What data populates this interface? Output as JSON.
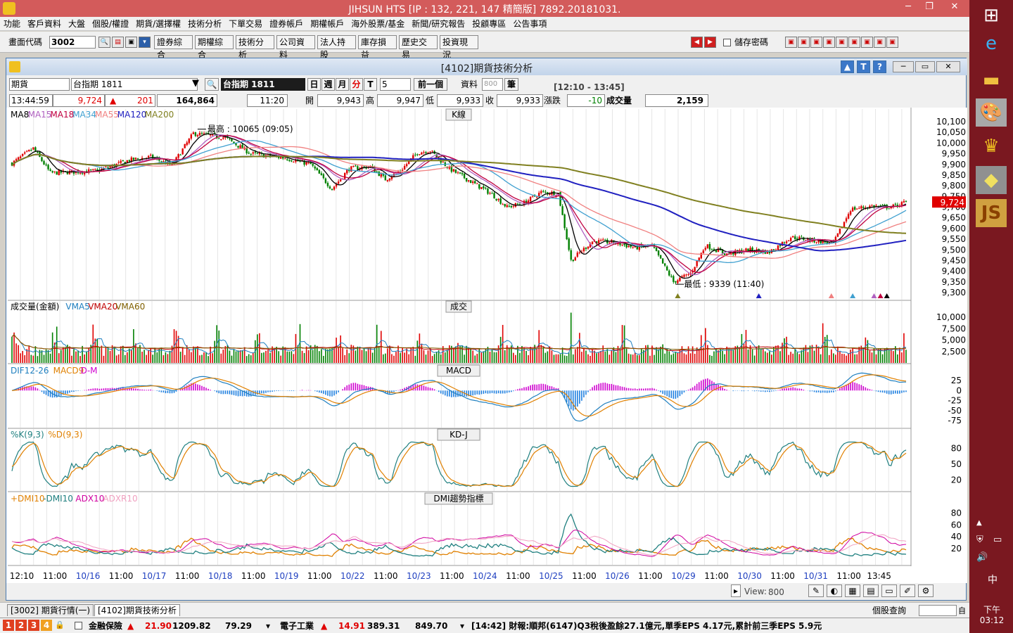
{
  "app": {
    "title": "JIHSUN HTS    [IP : 132, 221, 147 精簡版] 7892.20181031."
  },
  "menu": [
    "功能",
    "客戶資料",
    "大盤",
    "個股/權證",
    "期貨/選擇權",
    "技術分析",
    "下單交易",
    "證券帳戶",
    "期權帳戶",
    "海外股票/基金",
    "新聞/研究報告",
    "投顧專區",
    "公告事項"
  ],
  "toolbar": {
    "code_label": "畫面代碼",
    "code_value": "3002",
    "buttons": [
      "證券綜合",
      "期權綜合",
      "技術分析",
      "公司資料",
      "法人持股",
      "庫存損益",
      "歷史交易",
      "投資現況"
    ],
    "save_pwd": "儲存密碼"
  },
  "window": {
    "title": "[4102]期貨技術分析",
    "type_value": "期貨",
    "symbol_value": "台指期 1811",
    "symbol_display": "台指期 1811",
    "periods": [
      "日",
      "週",
      "月",
      "分",
      "T"
    ],
    "interval_value": "5",
    "prev_btn": "前一個",
    "data_label": "資料",
    "data_count": "800",
    "data_unit": "筆",
    "time_range": "[12:10 - 13:45]"
  },
  "quote": {
    "time": "13:44:59",
    "price": "9,724",
    "change": "201",
    "volume_total": "164,864",
    "bar_time": "11:20",
    "open_label": "開",
    "open": "9,943",
    "high_label": "高",
    "high": "9,947",
    "low_label": "低",
    "low": "9,933",
    "close_label": "收",
    "close": "9,933",
    "chg_label": "漲跌",
    "chg": "-10",
    "vol_label": "成交量",
    "vol": "2,159"
  },
  "panels": {
    "k": {
      "title": "K線",
      "legend": [
        {
          "t": "MA8",
          "c": "#000000"
        },
        {
          "t": "MA15",
          "c": "#b060c0"
        },
        {
          "t": "MA18",
          "c": "#c00040"
        },
        {
          "t": "MA34",
          "c": "#40a0d0"
        },
        {
          "t": "MA55",
          "c": "#f08080"
        },
        {
          "t": "MA120",
          "c": "#2020c0"
        },
        {
          "t": "MA200",
          "c": "#808020"
        }
      ],
      "high_note": "最高 : 10065 (09:05)",
      "low_note": "最低 : 9339 (11:40)",
      "ticks": [
        "10,100",
        "10,050",
        "10,000",
        "9,950",
        "9,900",
        "9,850",
        "9,800",
        "9,750",
        "9,700",
        "9,650",
        "9,600",
        "9,550",
        "9,500",
        "9,450",
        "9,400",
        "9,350",
        "9,300"
      ],
      "last_price": "9,724"
    },
    "vol": {
      "title": "成交",
      "legend": [
        {
          "t": "成交量(金額)",
          "c": "#000000"
        },
        {
          "t": "VMA5",
          "c": "#2080c0"
        },
        {
          "t": "VMA20",
          "c": "#c00000"
        },
        {
          "t": "VMA60",
          "c": "#806000"
        }
      ],
      "ticks": [
        "10,000",
        "7,500",
        "5,000",
        "2,500"
      ]
    },
    "macd": {
      "title": "MACD",
      "legend": [
        {
          "t": "DIF12-26",
          "c": "#2080c0"
        },
        {
          "t": "MACD9",
          "c": "#e08000"
        },
        {
          "t": "D-M",
          "c": "#d000d0"
        }
      ],
      "ticks": [
        "25",
        "0",
        "-25",
        "-50",
        "-75"
      ]
    },
    "kd": {
      "title": "KD-J",
      "legend": [
        {
          "t": "%K(9,3)",
          "c": "#208080"
        },
        {
          "t": "%D(9,3)",
          "c": "#e08000"
        }
      ],
      "ticks": [
        "80",
        "50",
        "20"
      ]
    },
    "dmi": {
      "title": "DMI趨勢指標",
      "legend": [
        {
          "t": "+DMI10",
          "c": "#e08000"
        },
        {
          "t": "-DMI10",
          "c": "#208080"
        },
        {
          "t": "ADX10",
          "c": "#d000a0"
        },
        {
          "t": "ADXR10",
          "c": "#f0a0c0"
        }
      ],
      "ticks": [
        "80",
        "60",
        "40",
        "20"
      ]
    }
  },
  "xaxis": [
    {
      "t": "12:10",
      "c": "#000"
    },
    {
      "t": "11:00",
      "c": "#000"
    },
    {
      "t": "10/16",
      "c": "#2040c0"
    },
    {
      "t": "11:00",
      "c": "#000"
    },
    {
      "t": "10/17",
      "c": "#2040c0"
    },
    {
      "t": "11:00",
      "c": "#000"
    },
    {
      "t": "10/18",
      "c": "#2040c0"
    },
    {
      "t": "11:00",
      "c": "#000"
    },
    {
      "t": "10/19",
      "c": "#2040c0"
    },
    {
      "t": "11:00",
      "c": "#000"
    },
    {
      "t": "10/22",
      "c": "#2040c0"
    },
    {
      "t": "11:00",
      "c": "#000"
    },
    {
      "t": "10/23",
      "c": "#2040c0"
    },
    {
      "t": "11:00",
      "c": "#000"
    },
    {
      "t": "10/24",
      "c": "#2040c0"
    },
    {
      "t": "11:00",
      "c": "#000"
    },
    {
      "t": "10/25",
      "c": "#2040c0"
    },
    {
      "t": "11:00",
      "c": "#000"
    },
    {
      "t": "10/26",
      "c": "#2040c0"
    },
    {
      "t": "11:00",
      "c": "#000"
    },
    {
      "t": "10/29",
      "c": "#2040c0"
    },
    {
      "t": "11:00",
      "c": "#000"
    },
    {
      "t": "10/30",
      "c": "#2040c0"
    },
    {
      "t": "11:00",
      "c": "#000"
    },
    {
      "t": "10/31",
      "c": "#2040c0"
    },
    {
      "t": "11:00",
      "c": "#000"
    },
    {
      "t": "13:45",
      "c": "#000"
    }
  ],
  "view": {
    "label": "View:",
    "value": "800"
  },
  "tabs": [
    "[3002] 期貨行情(一)",
    "[4102]期貨技術分析"
  ],
  "status": {
    "query_label": "個股查詢"
  },
  "bottom": {
    "nums": [
      "1",
      "2",
      "3",
      "4"
    ],
    "item1_name": "金融保險",
    "item1_price": "21.90",
    "item1_v1": "1209.82",
    "item1_v2": "79.29",
    "item2_name": "電子工業",
    "item2_price": "14.91",
    "item2_v1": "389.31",
    "item2_v2": "849.70",
    "news": "[14:42] 財報:順邦(6147)Q3稅後盈餘27.1億元,單季EPS 4.17元,累計前三季EPS 5.9元"
  },
  "sys": {
    "ime": "中",
    "clock": "下午 03:12"
  },
  "colors": {
    "up": "#e00000",
    "down": "#008000",
    "accent": "#d35b5b"
  }
}
